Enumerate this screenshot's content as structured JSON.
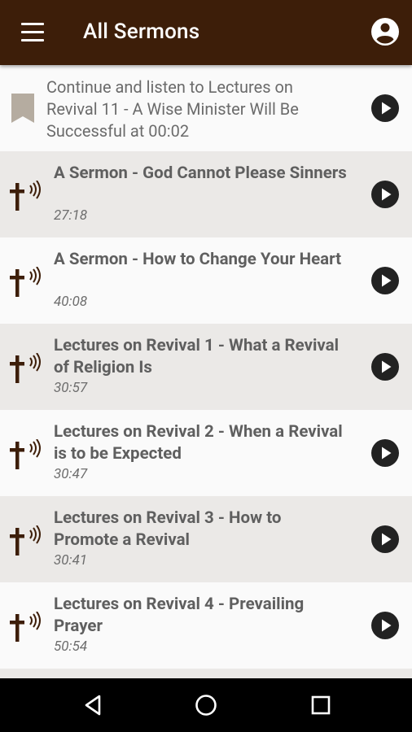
{
  "app_bar": {
    "title": "All Sermons",
    "menu_icon": "hamburger-menu-icon",
    "account_icon": "account-circle-icon",
    "background": "#3d1e09"
  },
  "resume": {
    "text": "Continue and listen to Lectures on Revival 11 - A Wise Minister Will Be Successful at 00:02",
    "icon": "bookmark-icon"
  },
  "sermons": [
    {
      "title": "A Sermon - God Cannot Please Sinners",
      "duration": "27:18"
    },
    {
      "title": "A Sermon - How to Change Your Heart",
      "duration": "40:08"
    },
    {
      "title": "Lectures on Revival 1 - What a Revival of Religion Is",
      "duration": "30:57"
    },
    {
      "title": "Lectures on Revival 2 - When a Revival is to be Expected",
      "duration": "30:47"
    },
    {
      "title": "Lectures on Revival 3 - How to Promote a Revival",
      "duration": "30:41"
    },
    {
      "title": "Lectures on Revival 4 - Prevailing Prayer",
      "duration": "50:54"
    }
  ],
  "nav_bar": {
    "back_icon": "back-triangle-icon",
    "home_icon": "home-circle-icon",
    "recents_icon": "recents-square-icon"
  },
  "colors": {
    "cross": "#3d1e09",
    "row_light": "#fafafa",
    "row_dark": "#ebe9e7",
    "play_button": "#222222"
  }
}
